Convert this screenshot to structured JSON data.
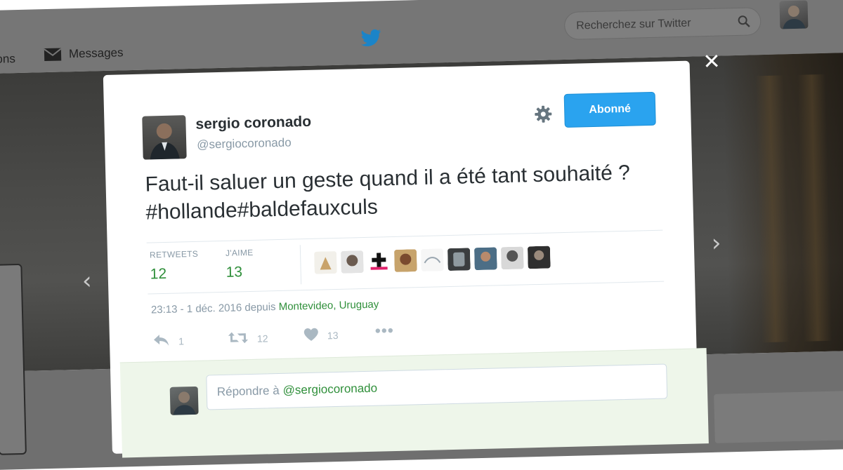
{
  "topbar": {
    "notifications_label": "ications",
    "messages_label": "Messages",
    "search_placeholder": "Recherchez sur Twitter"
  },
  "tweet": {
    "author_name": "sergio coronado",
    "author_handle": "@sergiocoronado",
    "follow_button_label": "Abonné",
    "text": "Faut-il saluer un geste quand il a été tant souhaité ? #hollande#baldefauxculs",
    "stats": {
      "retweets_label": "RETWEETS",
      "retweets_value": "12",
      "likes_label": "J'AIME",
      "likes_value": "13"
    },
    "likers_count": 9,
    "meta": {
      "time": "23:13 - 1 déc. 2016 depuis ",
      "location": "Montevideo, Uruguay"
    },
    "actions": {
      "reply_count": "1",
      "retweet_count": "12",
      "like_count": "13"
    }
  },
  "reply": {
    "prefix": "Répondre à",
    "mention": "@sergiocoronado"
  },
  "colors": {
    "accent_blue": "#2aa3ef",
    "green_text": "#2f8f3a",
    "overlay_gray": "#767676"
  }
}
